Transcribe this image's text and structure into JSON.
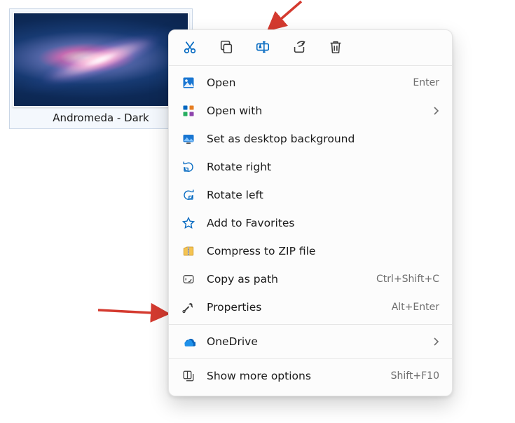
{
  "file": {
    "caption": "Andromeda - Dark"
  },
  "toolbar": {
    "cut": {
      "name": "cut-icon"
    },
    "copy": {
      "name": "copy-icon"
    },
    "rename": {
      "name": "rename-icon"
    },
    "share": {
      "name": "share-icon"
    },
    "delete": {
      "name": "delete-icon"
    }
  },
  "menu": {
    "open": {
      "label": "Open",
      "hint": "Enter"
    },
    "open_with": {
      "label": "Open with"
    },
    "set_wallpaper": {
      "label": "Set as desktop background"
    },
    "rotate_right": {
      "label": "Rotate right"
    },
    "rotate_left": {
      "label": "Rotate left"
    },
    "add_favorites": {
      "label": "Add to Favorites"
    },
    "compress_zip": {
      "label": "Compress to ZIP file"
    },
    "copy_as_path": {
      "label": "Copy as path",
      "hint": "Ctrl+Shift+C"
    },
    "properties": {
      "label": "Properties",
      "hint": "Alt+Enter"
    },
    "onedrive": {
      "label": "OneDrive"
    },
    "show_more": {
      "label": "Show more options",
      "hint": "Shift+F10"
    }
  }
}
